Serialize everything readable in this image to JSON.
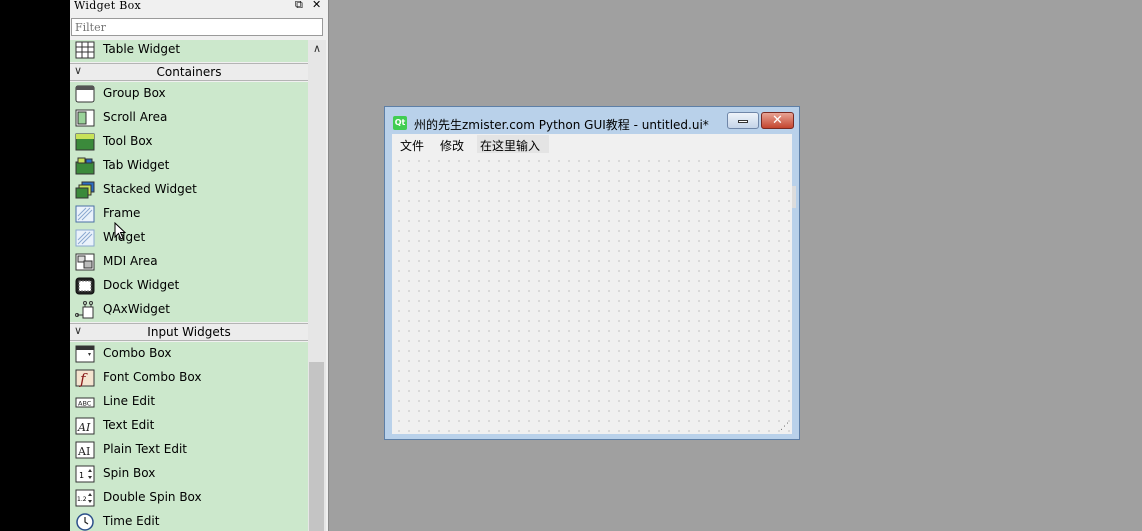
{
  "widget_box": {
    "title": "Widget Box",
    "filter_placeholder": "Filter",
    "float_icon": "float-window-icon",
    "close_icon": "close-icon"
  },
  "top_item": {
    "label": "Table Widget",
    "icon": "table-widget-icon"
  },
  "categories": {
    "containers": {
      "label": "Containers",
      "items": [
        {
          "label": "Group Box",
          "icon": "group-box-icon"
        },
        {
          "label": "Scroll Area",
          "icon": "scroll-area-icon"
        },
        {
          "label": "Tool Box",
          "icon": "tool-box-icon"
        },
        {
          "label": "Tab Widget",
          "icon": "tab-widget-icon"
        },
        {
          "label": "Stacked Widget",
          "icon": "stacked-widget-icon"
        },
        {
          "label": "Frame",
          "icon": "frame-icon"
        },
        {
          "label": "Widget",
          "icon": "widget-icon"
        },
        {
          "label": "MDI Area",
          "icon": "mdi-area-icon"
        },
        {
          "label": "Dock Widget",
          "icon": "dock-widget-icon"
        },
        {
          "label": "QAxWidget",
          "icon": "qaxwidget-icon"
        }
      ]
    },
    "input_widgets": {
      "label": "Input Widgets",
      "items": [
        {
          "label": "Combo Box",
          "icon": "combo-box-icon"
        },
        {
          "label": "Font Combo Box",
          "icon": "font-combo-box-icon"
        },
        {
          "label": "Line Edit",
          "icon": "line-edit-icon"
        },
        {
          "label": "Text Edit",
          "icon": "text-edit-icon"
        },
        {
          "label": "Plain Text Edit",
          "icon": "plain-text-edit-icon"
        },
        {
          "label": "Spin Box",
          "icon": "spin-box-icon"
        },
        {
          "label": "Double Spin Box",
          "icon": "double-spin-box-icon"
        },
        {
          "label": "Time Edit",
          "icon": "time-edit-icon"
        }
      ]
    }
  },
  "form_window": {
    "title": "州的先生zmister.com Python GUI教程 - untitled.ui*",
    "icon": "qt-icon",
    "menu": [
      "文件",
      "修改",
      "在这里输入"
    ]
  },
  "colors": {
    "item_bg": "#cce8cc",
    "desktop": "#a0a0a0",
    "title_bar": "#b9d1ea",
    "close": "#c4452f"
  }
}
